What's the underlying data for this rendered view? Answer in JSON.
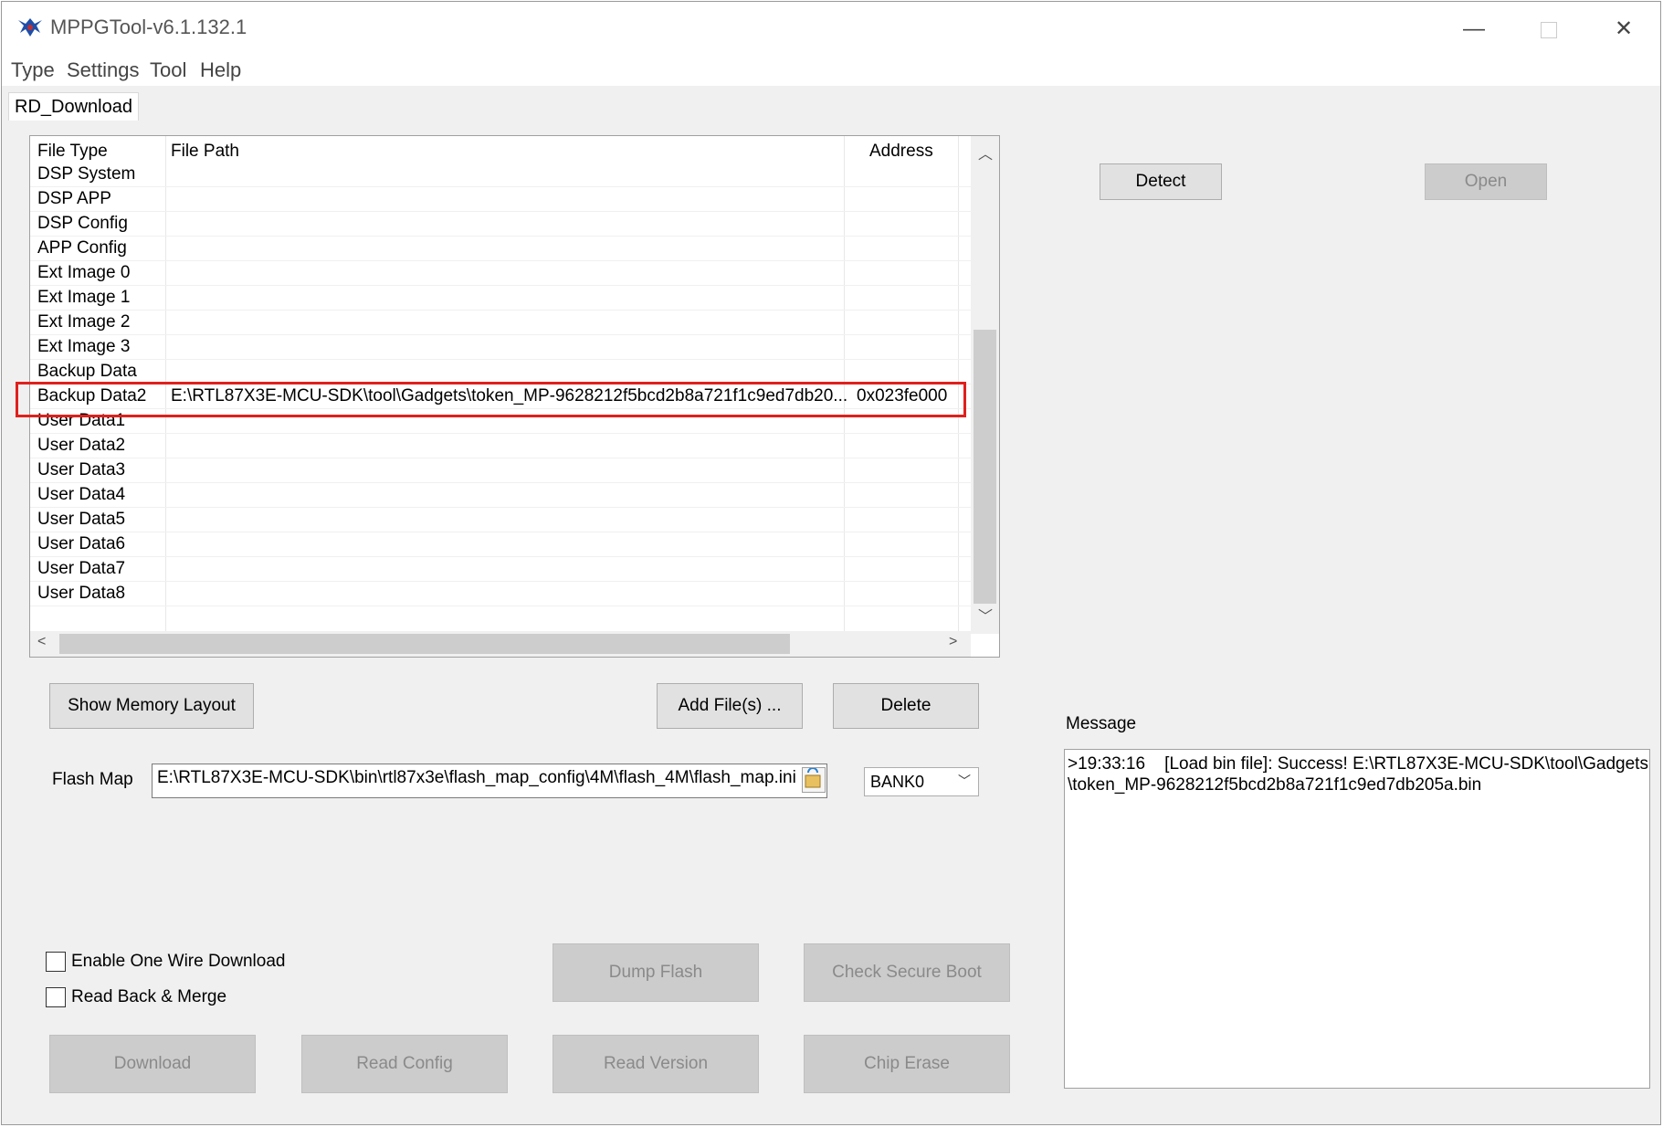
{
  "window": {
    "title": "MPPGTool-v6.1.132.1",
    "controls": [
      "minimize",
      "maximize",
      "close"
    ]
  },
  "menu": [
    "Type",
    "Settings",
    "Tool",
    "Help"
  ],
  "tab": "RD_Download",
  "table": {
    "headers": [
      "File Type",
      "File Path",
      "Address"
    ],
    "rows": [
      {
        "type": "DSP System",
        "path": "",
        "address": ""
      },
      {
        "type": "DSP APP",
        "path": "",
        "address": ""
      },
      {
        "type": "DSP Config",
        "path": "",
        "address": ""
      },
      {
        "type": "APP Config",
        "path": "",
        "address": ""
      },
      {
        "type": "Ext Image 0",
        "path": "",
        "address": ""
      },
      {
        "type": "Ext Image 1",
        "path": "",
        "address": ""
      },
      {
        "type": "Ext Image 2",
        "path": "",
        "address": ""
      },
      {
        "type": "Ext Image 3",
        "path": "",
        "address": ""
      },
      {
        "type": "Backup Data",
        "path": "",
        "address": ""
      },
      {
        "type": "Backup Data2",
        "path": "E:\\RTL87X3E-MCU-SDK\\tool\\Gadgets\\token_MP-9628212f5bcd2b8a721f1c9ed7db20...",
        "address": "0x023fe000"
      },
      {
        "type": "User Data1",
        "path": "",
        "address": ""
      },
      {
        "type": "User Data2",
        "path": "",
        "address": ""
      },
      {
        "type": "User Data3",
        "path": "",
        "address": ""
      },
      {
        "type": "User Data4",
        "path": "",
        "address": ""
      },
      {
        "type": "User Data5",
        "path": "",
        "address": ""
      },
      {
        "type": "User Data6",
        "path": "",
        "address": ""
      },
      {
        "type": "User Data7",
        "path": "",
        "address": ""
      },
      {
        "type": "User Data8",
        "path": "",
        "address": ""
      }
    ]
  },
  "buttons": {
    "detect": "Detect",
    "open": "Open",
    "show_memory": "Show Memory Layout",
    "add_files": "Add File(s) ...",
    "delete": "Delete",
    "dump_flash": "Dump Flash",
    "check_secure_boot": "Check Secure Boot",
    "download": "Download",
    "read_config": "Read Config",
    "read_version": "Read Version",
    "chip_erase": "Chip Erase"
  },
  "flash_map": {
    "label": "Flash Map",
    "value": "E:\\RTL87X3E-MCU-SDK\\bin\\rtl87x3e\\flash_map_config\\4M\\flash_4M\\flash_map.ini",
    "bank": "BANK0"
  },
  "checkboxes": {
    "one_wire": "Enable One Wire Download",
    "read_back": "Read Back & Merge"
  },
  "message": {
    "label": "Message",
    "line1": ">19:33:16    [Load bin file]: Success! E:\\RTL87X3E-MCU-SDK\\tool\\Gadgets",
    "line2": "\\token_MP-9628212f5bcd2b8a721f1c9ed7db205a.bin"
  }
}
